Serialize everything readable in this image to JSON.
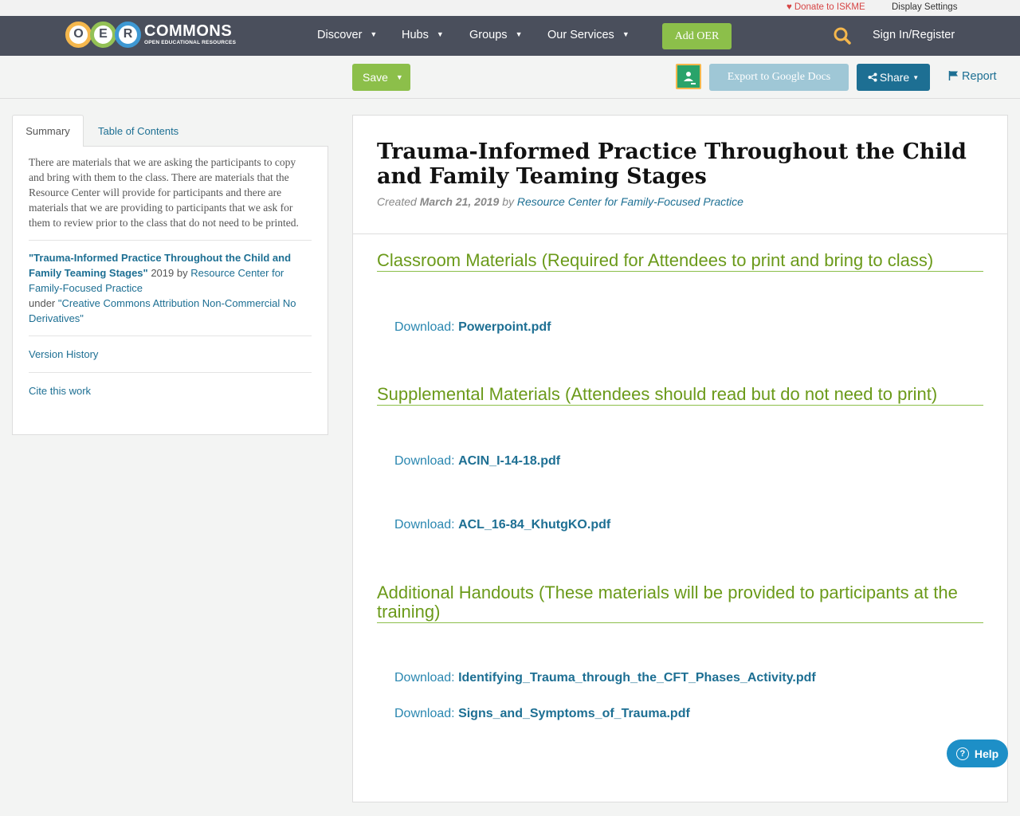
{
  "utility": {
    "donate_label": "Donate to ISKME",
    "display_settings_label": "Display Settings"
  },
  "nav": {
    "logo_letters": [
      "O",
      "E",
      "R"
    ],
    "logo_word": "COMMONS",
    "logo_tagline": "OPEN EDUCATIONAL RESOURCES",
    "items": [
      {
        "label": "Discover"
      },
      {
        "label": "Hubs"
      },
      {
        "label": "Groups"
      },
      {
        "label": "Our Services"
      }
    ],
    "add_oer_label": "Add OER",
    "signin_label": "Sign In/Register"
  },
  "toolbar": {
    "save_label": "Save",
    "export_label": "Export to Google Docs",
    "share_label": "Share",
    "report_label": "Report"
  },
  "sidebar": {
    "tabs": [
      {
        "label": "Summary",
        "active": true
      },
      {
        "label": "Table of Contents",
        "active": false
      }
    ],
    "summary": "There are materials that we are asking the participants to copy and bring with them to the class. There are materials that the Resource Center will provide for participants and there are materials that we are providing to participants that we ask for them to review prior to the class that do not need to be printed.",
    "attribution": {
      "title": "\"Trauma-Informed Practice Throughout the Child and Family Teaming Stages\"",
      "year_by": " 2019 by ",
      "author": "Resource Center for Family-Focused Practice",
      "under": "under ",
      "license": "\"Creative Commons Attribution Non-Commercial No Derivatives\""
    },
    "version_history_label": "Version History",
    "cite_label": "Cite this work"
  },
  "main": {
    "title": "Trauma-Informed Practice Throughout the Child and Family Teaming Stages",
    "created_label": "Created",
    "date": "March 21, 2019",
    "by_label": "by",
    "author": "Resource Center for Family-Focused Practice",
    "download_label": "Download:",
    "sections": [
      {
        "heading": "Classroom Materials (Required for Attendees to print and bring to class)",
        "files": [
          "Powerpoint.pdf"
        ]
      },
      {
        "heading": "Supplemental Materials (Attendees should read but do not need to print)",
        "files": [
          "ACIN_I-14-18.pdf",
          "ACL_16-84_KhutgKO.pdf"
        ]
      },
      {
        "heading": "Additional Handouts (These materials will be provided to participants at the training)",
        "files": [
          "Identifying_Trauma_through_the_CFT_Phases_Activity.pdf",
          "Signs_and_Symptoms_of_Trauma.pdf"
        ]
      }
    ]
  },
  "help_label": "Help",
  "colors": {
    "nav_bg": "#4a4f5c",
    "green": "#8cbf4a",
    "link_blue": "#1d6f93",
    "section_green": "#6b9a1a"
  }
}
